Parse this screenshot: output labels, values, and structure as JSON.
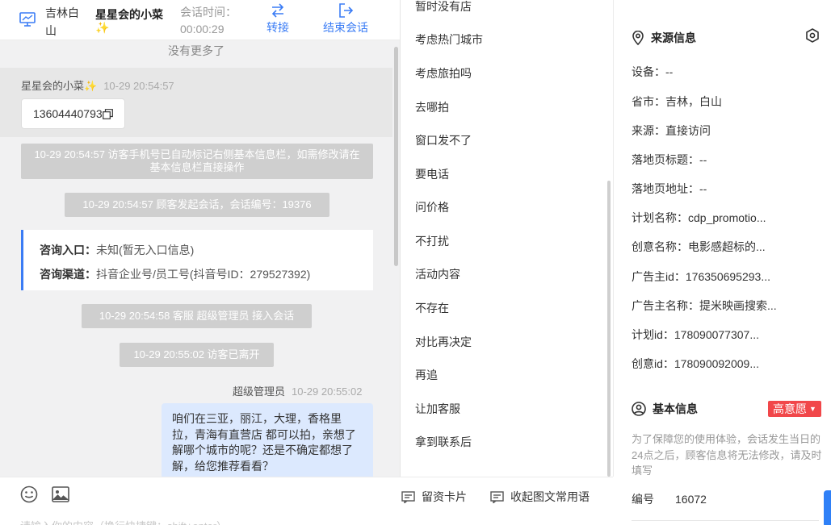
{
  "header": {
    "location": "吉林白山",
    "visitor_name": "星星会的小菜",
    "visitor_emoji": "✨",
    "session_time_label": "会话时间：",
    "session_time_value": "00:00:29",
    "transfer_label": "转接",
    "end_label": "结束会话"
  },
  "chat": {
    "no_more": "没有更多了",
    "visitor_msg": {
      "sender": "星星会的小菜✨",
      "time": "10-29 20:54:57",
      "text": "13604440793"
    },
    "system_1": "10-29 20:54:57 访客手机号已自动标记右侧基本信息栏，如需修改请在基本信息栏直接操作",
    "system_2": "10-29 20:54:57 顾客发起会话，会话编号：19376",
    "entry": {
      "label": "咨询入口：",
      "value": "未知(暂无入口信息)"
    },
    "channel": {
      "label": "咨询渠道：",
      "value": "抖音企业号/员工号(抖音号ID：279527392)"
    },
    "system_3": "10-29 20:54:58 客服 超级管理员 接入会话",
    "system_4": "10-29 20:55:02 访客已离开",
    "agent_msg": {
      "sender": "超级管理员",
      "time": "10-29 20:55:02",
      "text": "咱们在三亚，丽江，大理，香格里拉，青海有直营店 都可以拍，亲想了解哪个城市的呢？还是不确定都想了解，给您推荐看看？"
    }
  },
  "composer": {
    "card_label": "留资卡片",
    "phrases_label": "收起图文常用语",
    "placeholder": "请输入你的内容（换行快捷键：shift+enter）"
  },
  "quick_replies": [
    "暂时没有店",
    "考虑热门城市",
    "考虑旅拍吗",
    "去哪拍",
    "窗口发不了",
    "要电话",
    "问价格",
    "不打扰",
    "活动内容",
    "不存在",
    "对比再决定",
    "再追",
    "让加客服",
    "拿到联系后"
  ],
  "source_info": {
    "title": "来源信息",
    "fields": [
      "设备：--",
      "省市：吉林，白山",
      "来源：直接访问",
      "落地页标题：--",
      "落地页地址：--",
      "计划名称：cdp_promotio...",
      "创意名称：电影感超标的...",
      "广告主id：176350695293...",
      "广告主名称：提米映画搜索...",
      "计划id：178090077307...",
      "创意id：178090092009..."
    ]
  },
  "basic_info": {
    "title": "基本信息",
    "intent_tag": "高意愿",
    "notice": "为了保障您的使用体验，会话发生当日的24点之后，顾客信息将无法修改，请及时填写",
    "id_label": "编号",
    "id_value": "16072"
  },
  "colors": {
    "accent": "#3a7cf5",
    "tag_red": "#f1474a",
    "agent_bubble": "#dce9fe"
  }
}
